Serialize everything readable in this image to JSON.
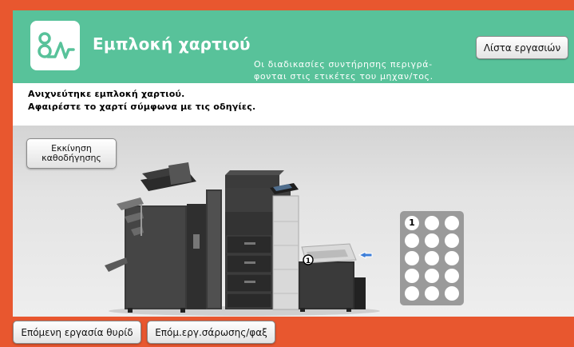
{
  "header": {
    "title": "Εμπλοκή χαρτιού",
    "maintenance_note_line1": "Οι διαδικασίες συντήρησης περιγρά-",
    "maintenance_note_line2": "φονται στις ετικέτες του μηχαν/τος.",
    "job_list_label": "Λίστα εργασιών",
    "icon": "paper-jam-icon"
  },
  "message": {
    "line1": "Ανιχνεύτηκε εμπλοκή χαρτιού.",
    "line2": "Αφαιρέστε το χαρτί σύμφωνα με τις οδηγίες."
  },
  "guide_button": {
    "line1": "Εκκίνηση",
    "line2": "καθοδήγησης"
  },
  "illustration": {
    "jam_marker": "1",
    "position_marker": "1"
  },
  "footer": {
    "next_job_label": "Επόμενη εργασία θυρίδ",
    "next_scan_fax_label": "Επόμ.εργ.σάρωσης/φαξ"
  },
  "colors": {
    "frame": "#e8572f",
    "header": "#58c29a",
    "logo_stroke": "#58c29a"
  }
}
